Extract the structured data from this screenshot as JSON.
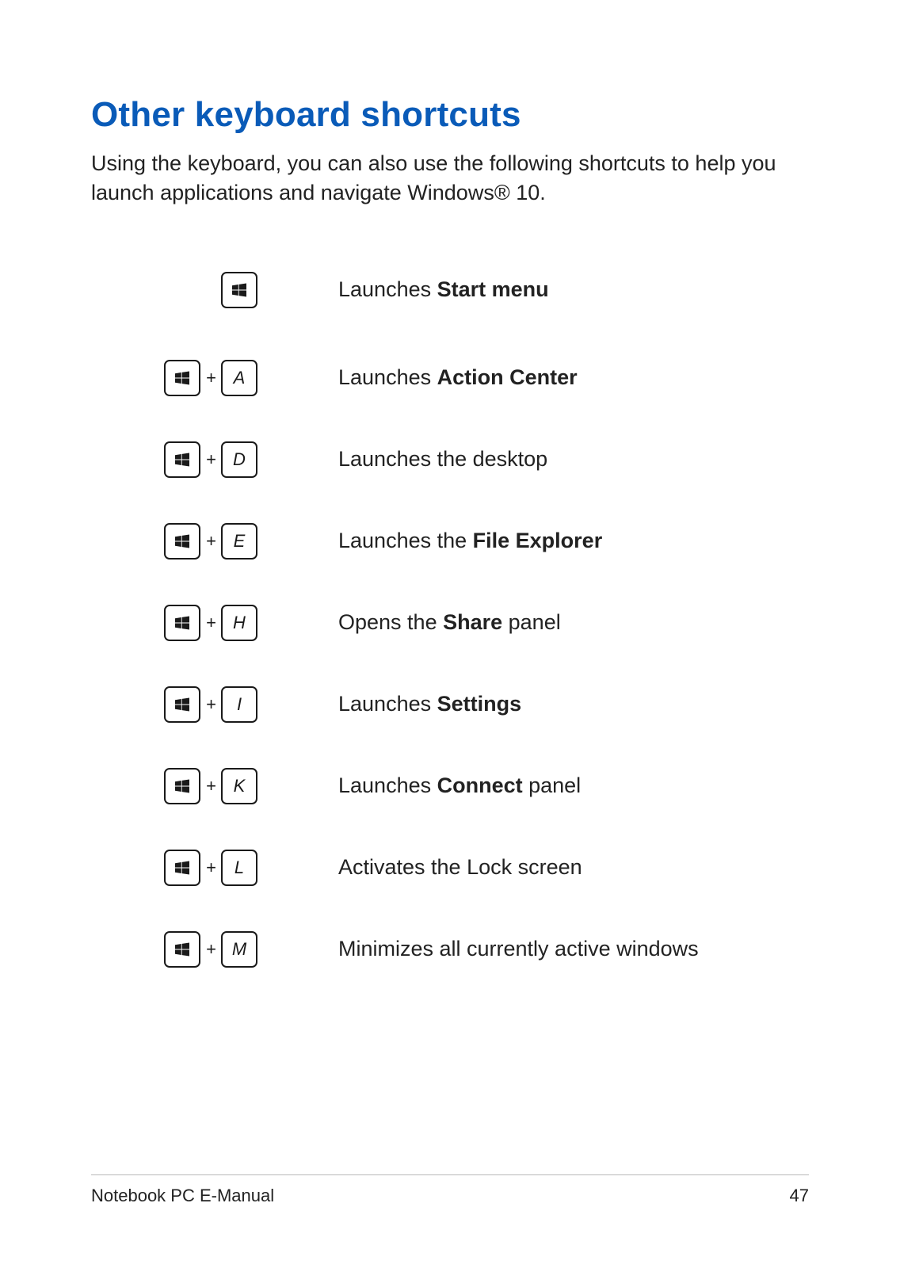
{
  "title": "Other keyboard shortcuts",
  "intro": "Using the keyboard, you can also use the following shortcuts to help you launch applications and navigate Windows® 10.",
  "shortcuts": [
    {
      "keys": [
        "win"
      ],
      "prefix": "Launches ",
      "bold": "Start menu",
      "suffix": ""
    },
    {
      "keys": [
        "win",
        "A"
      ],
      "prefix": "Launches ",
      "bold": "Action Center",
      "suffix": ""
    },
    {
      "keys": [
        "win",
        "D"
      ],
      "prefix": "Launches the desktop",
      "bold": "",
      "suffix": ""
    },
    {
      "keys": [
        "win",
        "E"
      ],
      "prefix": "Launches the ",
      "bold": "File Explorer",
      "suffix": ""
    },
    {
      "keys": [
        "win",
        "H"
      ],
      "prefix": "Opens the ",
      "bold": "Share",
      "suffix": " panel"
    },
    {
      "keys": [
        "win",
        "I"
      ],
      "prefix": "Launches ",
      "bold": "Settings",
      "suffix": ""
    },
    {
      "keys": [
        "win",
        "K"
      ],
      "prefix": "Launches ",
      "bold": "Connect",
      "suffix": " panel"
    },
    {
      "keys": [
        "win",
        "L"
      ],
      "prefix": "Activates the Lock screen",
      "bold": "",
      "suffix": ""
    },
    {
      "keys": [
        "win",
        "M"
      ],
      "prefix": "Minimizes all currently active windows",
      "bold": "",
      "suffix": ""
    }
  ],
  "plus": "+",
  "footer": {
    "label": "Notebook PC E-Manual",
    "page": "47"
  }
}
